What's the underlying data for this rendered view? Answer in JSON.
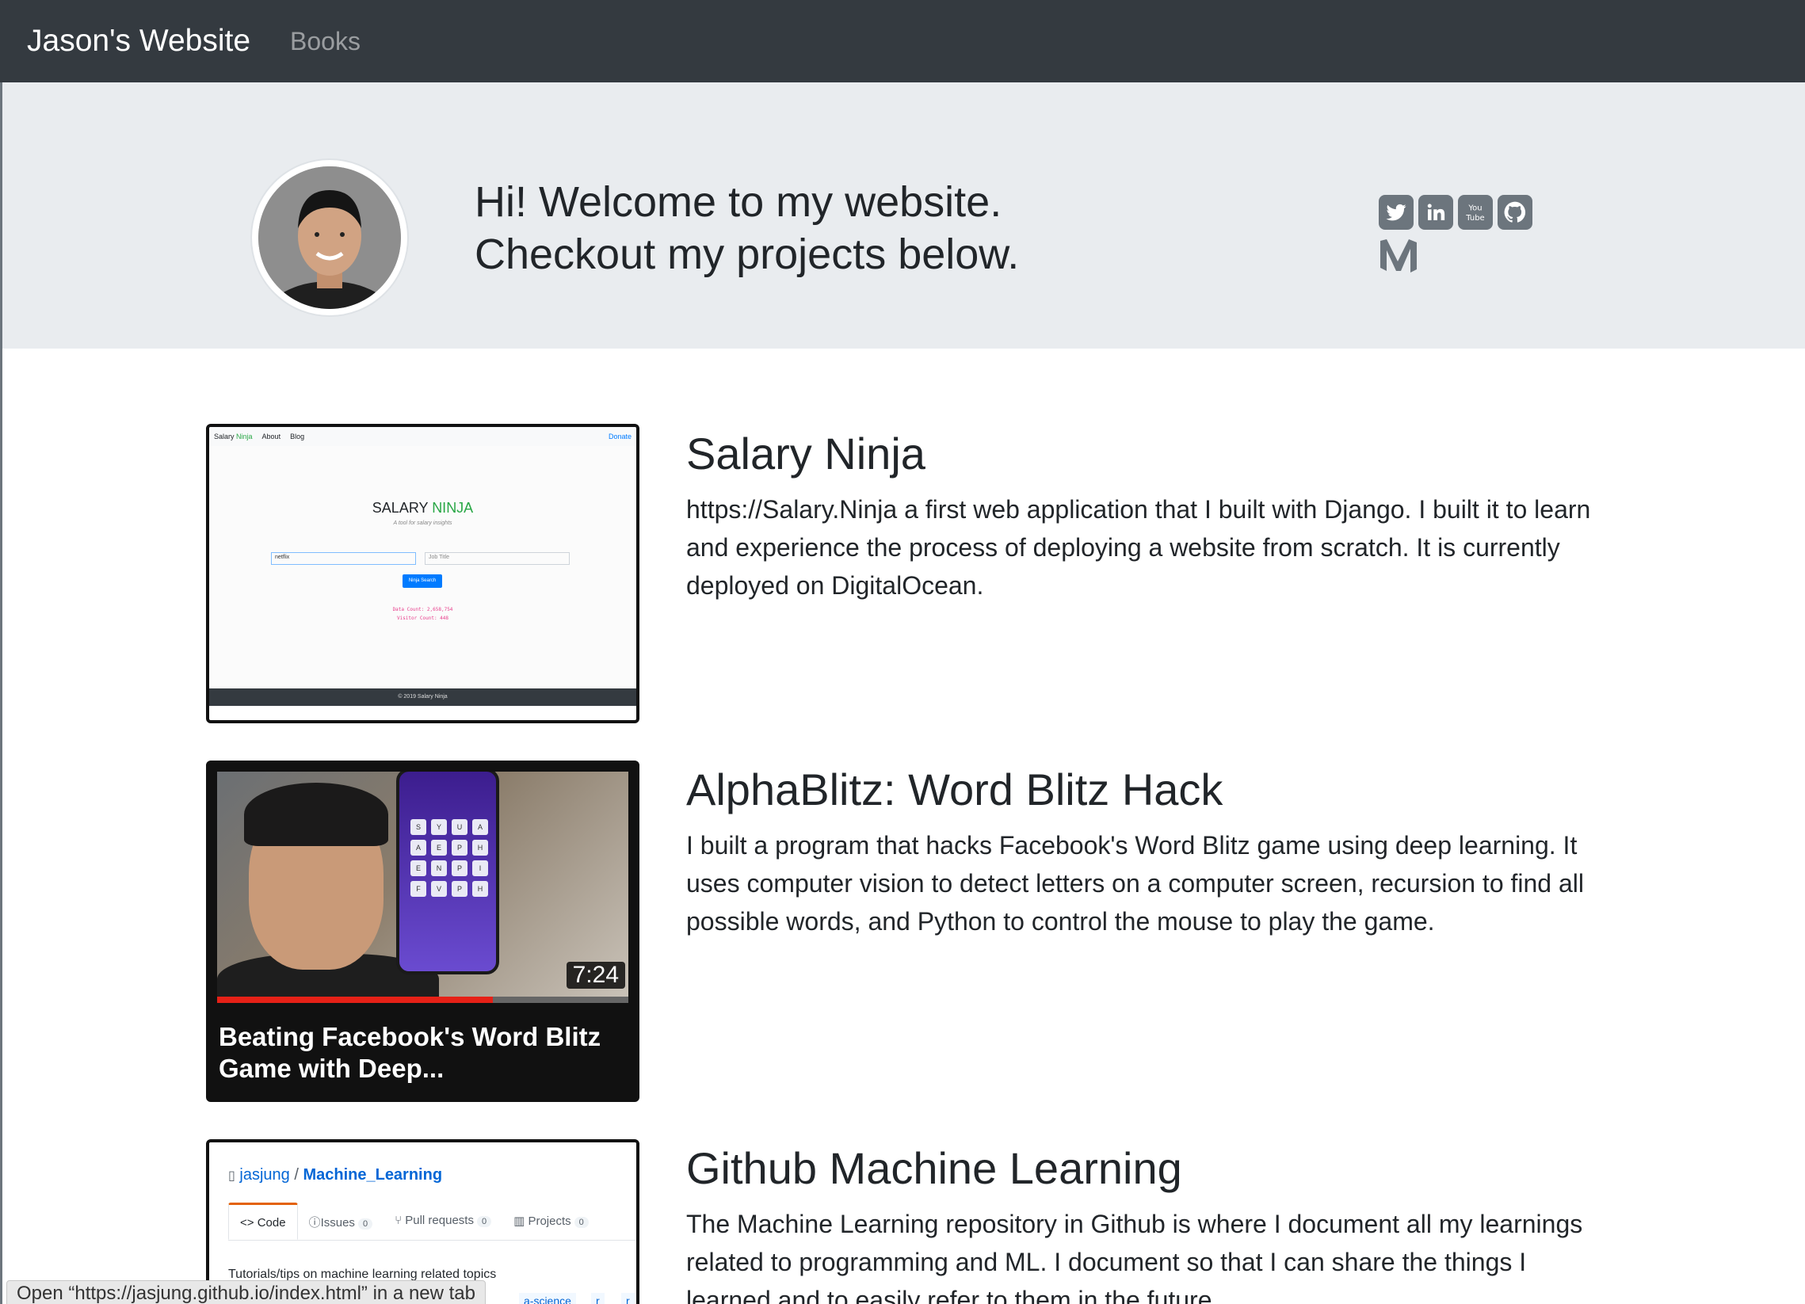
{
  "navbar": {
    "brand": "Jason's Website",
    "links": [
      "Books"
    ]
  },
  "hero": {
    "line1": "Hi! Welcome to my website.",
    "line2": "Checkout my projects below."
  },
  "socials": [
    "twitter-icon",
    "linkedin-icon",
    "youtube-icon",
    "github-icon",
    "medium-icon"
  ],
  "projects": [
    {
      "title": "Salary Ninja",
      "description": "https://Salary.Ninja a first web application that I built with Django. I built it to learn and experience the process of deploying a website from scratch. It is currently deployed on DigitalOcean.",
      "thumb": {
        "nav_brand_a": "Salary",
        "nav_brand_b": "Ninja",
        "nav_about": "About",
        "nav_blog": "Blog",
        "nav_donate": "Donate",
        "title_a": "SALARY ",
        "title_b": "NINJA",
        "subtitle": "A tool for salary insights",
        "input_company": "netflix",
        "input_job": "Job Title",
        "button": "Ninja Search",
        "stat_data": "Data Count: 2,658,754",
        "stat_visitor": "Visitor Count: 448",
        "footer": "© 2019 Salary Ninja"
      }
    },
    {
      "title": "AlphaBlitz: Word Blitz Hack",
      "description": "I built a program that hacks Facebook's Word Blitz game using deep learning. It uses computer vision to detect letters on a computer screen, recursion to find all possible words, and Python to control the mouse to play the game.",
      "thumb": {
        "duration": "7:24",
        "progress": 0.67,
        "video_title": "Beating Facebook's Word Blitz Game with Deep...",
        "tiles": [
          "S",
          "Y",
          "U",
          "A",
          "A",
          "E",
          "P",
          "H",
          "E",
          "N",
          "P",
          "I",
          "F",
          "V",
          "P",
          "H"
        ]
      }
    },
    {
      "title": "Github Machine Learning",
      "description": "The Machine Learning repository in Github is where I document all my learnings related to programming and ML. I document so that I can share the things I learned and to easily refer to them in the future.",
      "thumb": {
        "owner": "jasjung",
        "repo": "Machine_Learning",
        "tab_code": "Code",
        "tab_issues": "Issues",
        "issues_count": "0",
        "tab_pulls": "Pull requests",
        "pulls_count": "0",
        "tab_projects": "Projects",
        "projects_count": "0",
        "about": "Tutorials/tips on machine learning related topics",
        "topic_1": "a-science",
        "topic_2": "r",
        "topic_3": "r"
      }
    }
  ],
  "status_bar": "Open “https://jasjung.github.io/index.html” in a new tab",
  "colors": {
    "navbar": "#343a40",
    "jumbotron": "#e9ecef",
    "social": "#6c757d",
    "link": "#0366d6",
    "accent_green": "#28a745",
    "progress": "#e62117"
  }
}
